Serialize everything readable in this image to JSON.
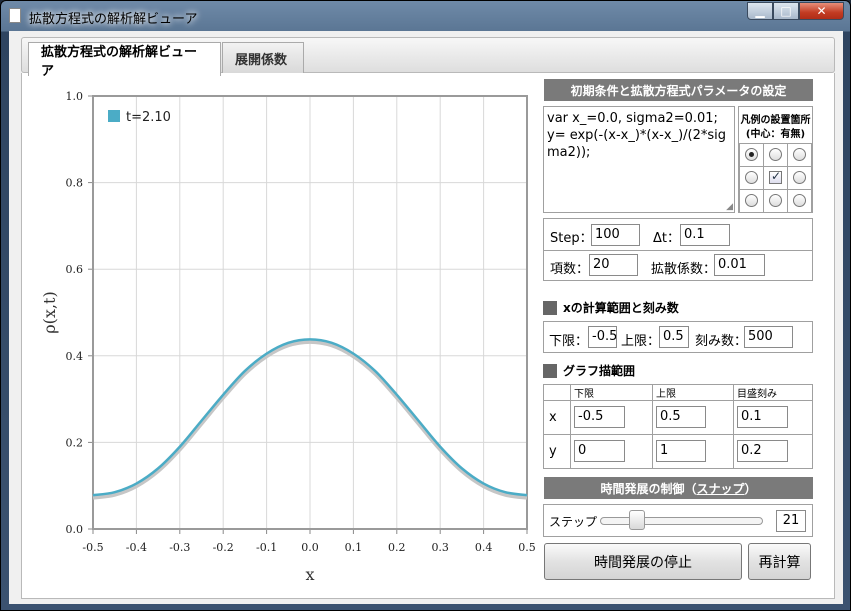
{
  "window": {
    "title": "拡散方程式の解析解ビューア"
  },
  "tabs": [
    {
      "label": "拡散方程式の解析解ビューア"
    },
    {
      "label": "展開係数"
    }
  ],
  "chart_data": {
    "type": "line",
    "xlabel": "x",
    "ylabel": "ρ(x,t)",
    "xlim": [
      -0.5,
      0.5
    ],
    "ylim": [
      0.0,
      1.0
    ],
    "x_ticks": [
      "-0.5",
      "-0.4",
      "-0.3",
      "-0.2",
      "-0.1",
      "0.0",
      "0.1",
      "0.2",
      "0.3",
      "0.4",
      "0.5"
    ],
    "y_ticks": [
      "0.0",
      "0.2",
      "0.4",
      "0.6",
      "0.8",
      "1.0"
    ],
    "grid": true,
    "legend_position": "top-left",
    "series": [
      {
        "name": "t=2.10",
        "color": "#4bacc6",
        "x": [
          -0.5,
          -0.45,
          -0.4,
          -0.35,
          -0.3,
          -0.25,
          -0.2,
          -0.15,
          -0.1,
          -0.05,
          0.0,
          0.05,
          0.1,
          0.15,
          0.2,
          0.25,
          0.3,
          0.35,
          0.4,
          0.45,
          0.5
        ],
        "y": [
          0.078,
          0.085,
          0.105,
          0.14,
          0.19,
          0.25,
          0.31,
          0.365,
          0.405,
          0.43,
          0.438,
          0.43,
          0.405,
          0.365,
          0.31,
          0.25,
          0.19,
          0.14,
          0.105,
          0.085,
          0.078
        ]
      }
    ]
  },
  "init": {
    "header": "初期条件と拡散方程式パラメータの設定",
    "code": "var x_=0.0, sigma2=0.01;\ny= exp(-(x-x_)*(x-x_)/(2*sigma2));"
  },
  "legend_pos": {
    "title": "凡例の設置箇所",
    "subtitle": "(中心：有無)"
  },
  "params": {
    "step_label": "Step：",
    "step": "100",
    "dt_label": "Δt：",
    "dt": "0.1",
    "terms_label": "項数：",
    "terms": "20",
    "diff_label": "拡散係数：",
    "diff": "0.01"
  },
  "xrange": {
    "header": "xの計算範囲と刻み数",
    "lower_label": "下限：",
    "lower": "-0.5",
    "upper_label": "上限：",
    "upper": "0.5",
    "div_label": "刻み数：",
    "div": "500"
  },
  "graph": {
    "header": "グラフ描範囲",
    "col_lower": "下限",
    "col_upper": "上限",
    "col_tick": "目盛刻み",
    "row_x": "x",
    "row_y": "y",
    "x_lower": "-0.5",
    "x_upper": "0.5",
    "x_tick": "0.1",
    "y_lower": "0",
    "y_upper": "1",
    "y_tick": "0.2"
  },
  "time": {
    "header": "時間発展の制御",
    "snap": "スナップ",
    "open": "（",
    "close": "）",
    "step_label": "ステップ",
    "step_value": "21",
    "slider": 0.2
  },
  "buttons": {
    "stop": "時間発展の停止",
    "recalc": "再計算"
  }
}
